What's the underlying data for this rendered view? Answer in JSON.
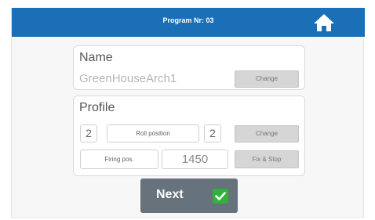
{
  "header": {
    "title": "Program Nr: 03",
    "home_icon": "home-icon"
  },
  "name_section": {
    "title": "Name",
    "value": "GreenHouseArch1",
    "change_label": "Change"
  },
  "profile_section": {
    "title": "Profile",
    "left_count": "2",
    "roll_position_label": "Roll position",
    "right_count": "2",
    "change_label": "Change",
    "firing_pos_label": "Firing pos.",
    "firing_pos_value": "1450",
    "fix_stop_label": "Fix & Stop"
  },
  "footer": {
    "next_label": "Next",
    "check_icon": "check-icon"
  },
  "colors": {
    "header_blue": "#1a6fb7",
    "next_button_gray": "#66727c",
    "check_green": "#2fb33a"
  }
}
